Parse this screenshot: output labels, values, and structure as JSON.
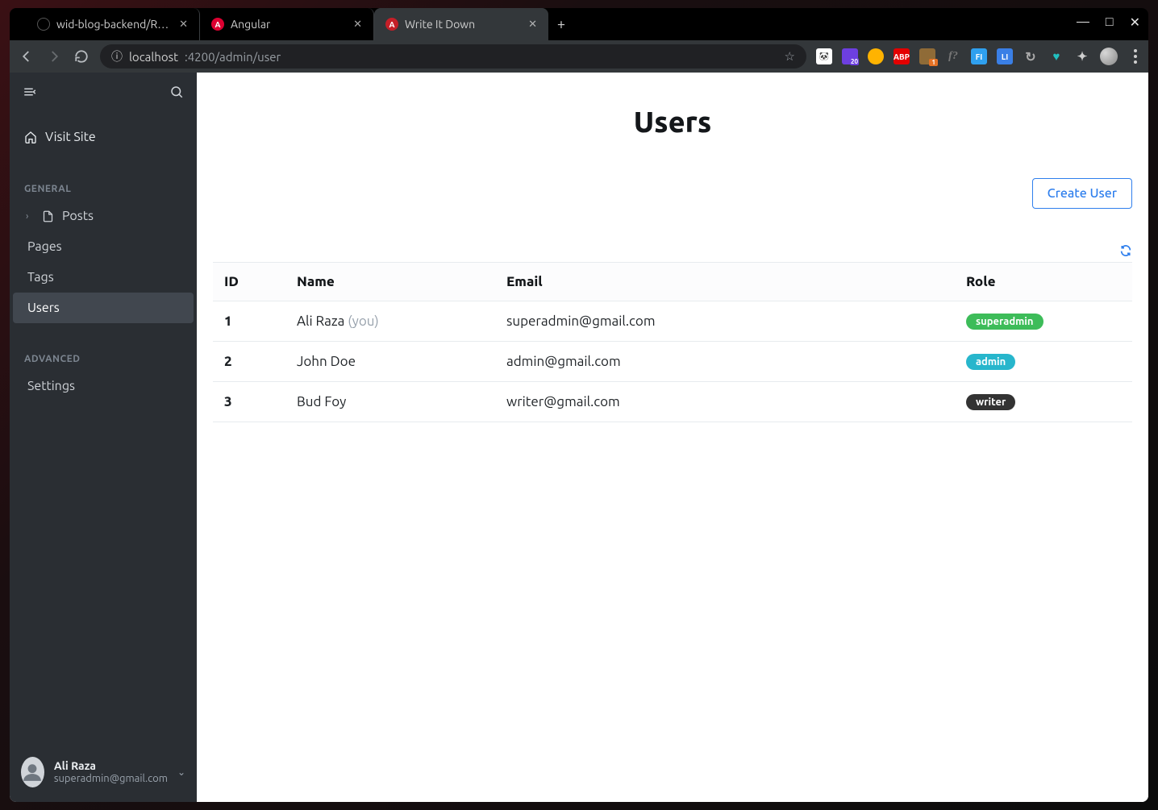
{
  "browser": {
    "tabs": [
      {
        "title": "wid-blog-backend/README",
        "favicon": "github",
        "active": false
      },
      {
        "title": "Angular",
        "favicon": "angular",
        "active": false
      },
      {
        "title": "Write It Down",
        "favicon": "wid",
        "active": true
      }
    ],
    "url": {
      "host": "localhost",
      "port_path": ":4200/admin/user"
    }
  },
  "sidebar": {
    "visit_site": "Visit Site",
    "groups": [
      {
        "label": "GENERAL",
        "items": [
          {
            "label": "Posts",
            "icon": "doc",
            "expandable": true
          },
          {
            "label": "Pages"
          },
          {
            "label": "Tags"
          },
          {
            "label": "Users",
            "active": true
          }
        ]
      },
      {
        "label": "ADVANCED",
        "items": [
          {
            "label": "Settings"
          }
        ]
      }
    ],
    "user": {
      "name": "Ali Raza",
      "email": "superadmin@gmail.com"
    }
  },
  "page": {
    "title": "Users",
    "create_button": "Create User",
    "table": {
      "headers": {
        "id": "ID",
        "name": "Name",
        "email": "Email",
        "role": "Role"
      },
      "rows": [
        {
          "id": "1",
          "name": "Ali Raza",
          "suffix": "(you)",
          "email": "superadmin@gmail.com",
          "role": "superadmin",
          "role_style": "superadmin"
        },
        {
          "id": "2",
          "name": "John Doe",
          "suffix": "",
          "email": "admin@gmail.com",
          "role": "admin",
          "role_style": "admin"
        },
        {
          "id": "3",
          "name": "Bud Foy",
          "suffix": "",
          "email": "writer@gmail.com",
          "role": "writer",
          "role_style": "writer"
        }
      ]
    }
  },
  "extensions": {
    "badge_count": "20",
    "tan_count": "1"
  }
}
